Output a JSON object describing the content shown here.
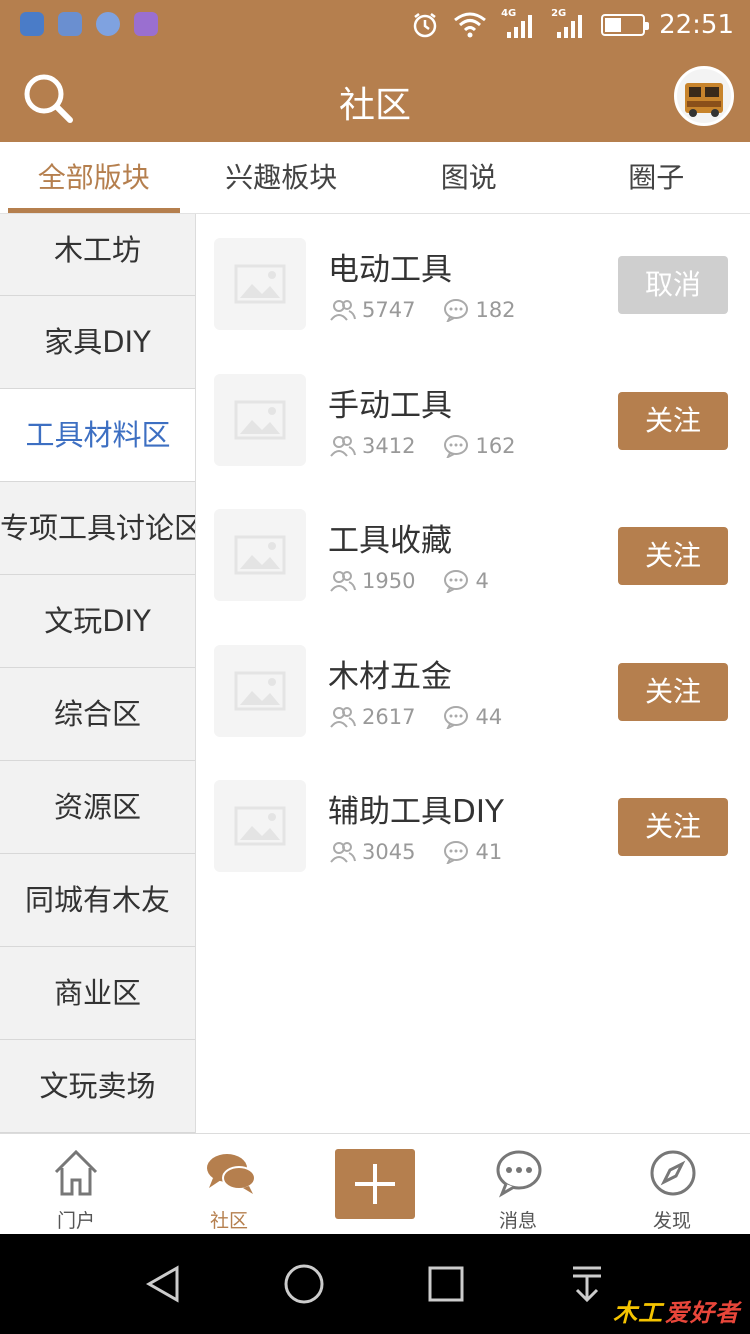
{
  "status_bar": {
    "time": "22:51",
    "net1": "4G",
    "net2": "2G",
    "battery_level": 0.45,
    "app_icons": [
      "app-icon-blue",
      "app-icon-bird",
      "location-icon",
      "gallery-icon"
    ]
  },
  "header": {
    "title": "社区"
  },
  "tabs": [
    {
      "label": "全部版块",
      "active": true
    },
    {
      "label": "兴趣板块",
      "active": false
    },
    {
      "label": "图说",
      "active": false
    },
    {
      "label": "圈子",
      "active": false
    }
  ],
  "sidebar": {
    "items": [
      {
        "label": "木工坊"
      },
      {
        "label": "家具DIY"
      },
      {
        "label": "工具材料区",
        "active": true
      },
      {
        "label": "专项工具讨论区"
      },
      {
        "label": "文玩DIY"
      },
      {
        "label": "综合区"
      },
      {
        "label": "资源区"
      },
      {
        "label": "同城有木友"
      },
      {
        "label": "商业区"
      },
      {
        "label": "文玩卖场"
      }
    ]
  },
  "forums": [
    {
      "title": "电动工具",
      "members": "5747",
      "posts": "182",
      "button": "取消",
      "following": true
    },
    {
      "title": "手动工具",
      "members": "3412",
      "posts": "162",
      "button": "关注",
      "following": false
    },
    {
      "title": "工具收藏",
      "members": "1950",
      "posts": "4",
      "button": "关注",
      "following": false
    },
    {
      "title": "木材五金",
      "members": "2617",
      "posts": "44",
      "button": "关注",
      "following": false
    },
    {
      "title": "辅助工具DIY",
      "members": "3045",
      "posts": "41",
      "button": "关注",
      "following": false
    }
  ],
  "bottom_nav": [
    {
      "label": "门户",
      "icon": "home-icon"
    },
    {
      "label": "社区",
      "icon": "community-icon",
      "active": true
    },
    {
      "label": "",
      "icon": "plus-icon"
    },
    {
      "label": "消息",
      "icon": "message-icon"
    },
    {
      "label": "发现",
      "icon": "compass-icon"
    }
  ],
  "watermark": {
    "part1": "木工",
    "part2": "爱好者"
  },
  "colors": {
    "brand": "#b57f4e",
    "active_text": "#3d6fc2",
    "cancel": "#cfcfcf"
  }
}
